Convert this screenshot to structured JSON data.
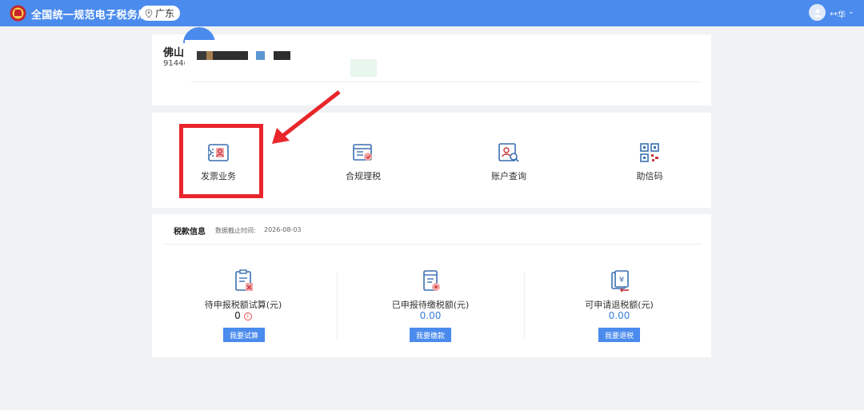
{
  "header": {
    "site_title": "全国统一规范电子税务局",
    "region": "广东",
    "username": "**华",
    "colors": {
      "bar": "#4a8bed"
    }
  },
  "company": {
    "name": "佛山",
    "code": "9144("
  },
  "services": [
    {
      "label": "发票业务",
      "icon": "invoice-icon"
    },
    {
      "label": "合规理税",
      "icon": "compliance-icon"
    },
    {
      "label": "账户查询",
      "icon": "account-search-icon"
    },
    {
      "label": "助信码",
      "icon": "qr-code-icon"
    }
  ],
  "tax_info": {
    "title": "税款信息",
    "time_label": "数据截止时间:",
    "time_value": "2026-08-03",
    "metrics": [
      {
        "label": "待申报税额试算(元)",
        "value": "0",
        "button": "我要试算"
      },
      {
        "label": "已申报待缴税额(元)",
        "value": "0.00",
        "button": "我要缴款"
      },
      {
        "label": "可申请退税额(元)",
        "value": "0.00",
        "button": "我要退税"
      }
    ]
  }
}
